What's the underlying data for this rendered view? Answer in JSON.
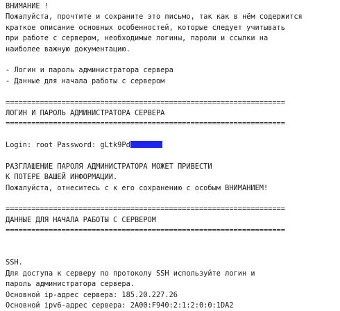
{
  "email": {
    "warning_title": "ВНИМАНИЕ !",
    "intro": [
      "Пожалуйста, прочтите и сохраните это письмо, так как в нём содержится",
      "краткое описание основных особенностей, которые следует учитывать",
      "при работе с сервером, необходимые логины, пароли и ссылки на",
      "наиболее важную документацию."
    ],
    "toc": [
      "- Логин и пароль администратора сервера",
      "- Данные для начала работы с сервером"
    ],
    "separator": "=================================================================",
    "section_admin": {
      "heading": "ЛОГИН И ПАРОЛЬ АДМИНИСТРАТОРА СЕРВЕРА",
      "credentials_text": "Login: root Password: gLtk9Pd",
      "warning": [
        "РАЗГЛАШЕНИЕ ПАРОЛЯ АДМИНИСТРАТОРА МОЖЕТ ПРИВЕСТИ",
        "К ПОТЕРЕ ВАШЕЙ ИНФОРМАЦИИ.",
        "Пожалуйста, отнеситесь с к его сохранению с особым ВНИМАНИЕМ!"
      ]
    },
    "section_start": {
      "heading": "ДАННЫЕ ДЛЯ НАЧАЛА РАБОТЫ С СЕРВЕРОМ",
      "ssh_title": "SSH.",
      "ssh_lines": [
        "Для доступа к серверу по протоколу SSH используйте логин и",
        "пароль администратора сервера.",
        "Основной ip-адрес сервера: 185.20.227.26",
        "Основной ipv6-адрес сервера: 2A00:F940:2:1:2:0:0:1DA2"
      ]
    }
  },
  "colors": {
    "text": "#1a1a1a",
    "redaction": "#1f25f0",
    "background": "#ffffff"
  }
}
